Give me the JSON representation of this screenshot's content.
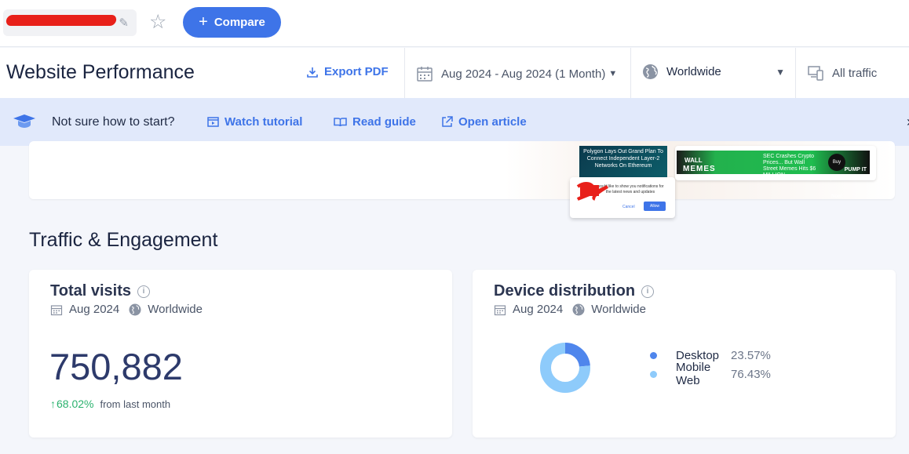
{
  "topbar": {
    "compare_label": "Compare"
  },
  "header": {
    "title": "Website Performance",
    "export_label": "Export PDF",
    "date_range": "Aug 2024 - Aug 2024 (1 Month)",
    "region": "Worldwide",
    "traffic": "All traffic"
  },
  "help": {
    "question": "Not sure how to start?",
    "watch_label": "Watch tutorial",
    "read_label": "Read guide",
    "article_label": "Open article"
  },
  "ad": {
    "headline": "Polygon Lays Out Grand Plan To Connect Independent Layer-2 Networks On Ethereum",
    "strip_brand": "WALL",
    "strip_memes": "MEMES",
    "strip_text": "SEC Crashes Crypto Prices... But Wall Street Memes Hits $6 MILLION",
    "strip_button": "Buy $WSM Now!",
    "strip_pump": "PUMP IT",
    "notif_text": "would like to show you notifications for the latest news and updates",
    "notif_cancel": "Cancel",
    "notif_allow": "Allow"
  },
  "section": {
    "title": "Traffic & Engagement"
  },
  "total_visits": {
    "title": "Total visits",
    "period": "Aug 2024",
    "region": "Worldwide",
    "value": "750,882",
    "change": "68.02%",
    "change_suffix": "from last month"
  },
  "device_distribution": {
    "title": "Device distribution",
    "period": "Aug 2024",
    "region": "Worldwide",
    "items": [
      {
        "label": "Desktop",
        "pct": "23.57%",
        "share": 23.57,
        "color": "#4f86ec"
      },
      {
        "label": "Mobile Web",
        "pct": "76.43%",
        "share": 76.43,
        "color": "#8ecbfb"
      }
    ]
  },
  "colors": {
    "accent": "#3e74e8",
    "positive": "#2bb26e",
    "help_bg": "#e1e9fb"
  }
}
